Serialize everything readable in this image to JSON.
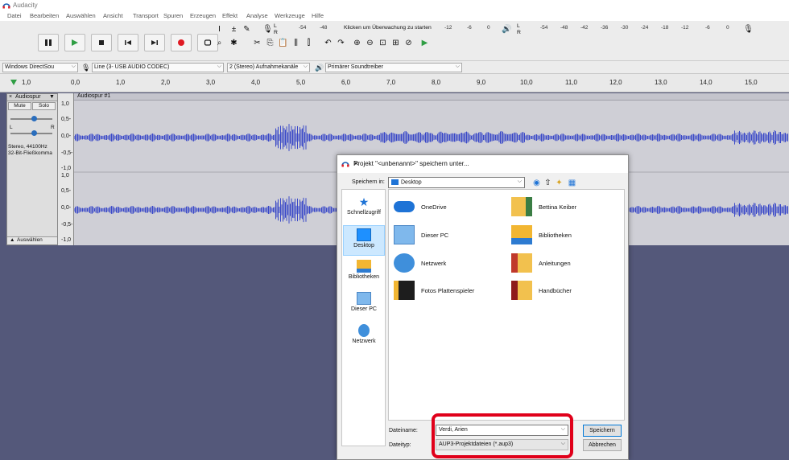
{
  "app": {
    "title": "Audacity"
  },
  "menu": [
    "Datei",
    "Bearbeiten",
    "Auswählen",
    "Ansicht",
    "Transport",
    "Spuren",
    "Erzeugen",
    "Effekt",
    "Analyse",
    "Werkzeuge",
    "Hilfe"
  ],
  "meter": {
    "record_hint": "Klicken um Überwachung zu starten",
    "rec_scale": [
      "-54",
      "-48",
      "-12",
      "-6",
      "0"
    ],
    "play_scale": [
      "-54",
      "-48",
      "-42",
      "-36",
      "-30",
      "-24",
      "-18",
      "-12",
      "-6",
      "0"
    ],
    "lr_left": "L",
    "lr_right": "R"
  },
  "devices": {
    "host": "Windows DirectSou",
    "input": "Line (3- USB AUDIO  CODEC)",
    "channels": "2 (Stereo) Aufnahmekanäle",
    "output": "Primärer Soundtreiber"
  },
  "ruler": {
    "start": "1,0",
    "ticks": [
      "0,0",
      "1,0",
      "2,0",
      "3,0",
      "4,0",
      "5,0",
      "6,0",
      "7,0",
      "8,0",
      "9,0",
      "10,0",
      "11,0",
      "12,0",
      "13,0",
      "14,0",
      "15,0"
    ]
  },
  "track": {
    "name": "Audiospur",
    "clip_name": "Audiospur #1",
    "mute": "Mute",
    "solo": "Solo",
    "pan_l": "L",
    "pan_r": "R",
    "info1": "Stereo, 44100Hz",
    "info2": "32-Bit-Fließkomma",
    "select": "Auswählen",
    "scale_top": [
      "1,0",
      "0,5-",
      "0,0-",
      "-0,5-",
      "-1,0"
    ],
    "scale_bottom": [
      "1,0",
      "0,5-",
      "0,0-",
      "-0,5-",
      "-1,0"
    ]
  },
  "dialog": {
    "title": "Projekt \"<unbenannt>\" speichern unter...",
    "save_in_label": "Speichern in:",
    "save_in_value": "Desktop",
    "nav": [
      "Schnellzugriff",
      "Desktop",
      "Bibliotheken",
      "Dieser PC",
      "Netzwerk"
    ],
    "files": [
      "OneDrive",
      "Dieser PC",
      "Netzwerk",
      "Fotos Plattenspieler",
      "Bettina Keiber",
      "Bibliotheken",
      "Anleitungen",
      "Handbücher"
    ],
    "filename_label": "Dateiname:",
    "filename_value": "Verdi, Arien",
    "filetype_label": "Dateityp:",
    "filetype_value": "AUP3-Projektdateien (*.aup3)",
    "save": "Speichern",
    "cancel": "Abbrechen"
  },
  "colors": {
    "accent": "#0078d7",
    "highlight": "#e0001a",
    "wave": "#3a48c8",
    "track_bg": "#54587a"
  }
}
